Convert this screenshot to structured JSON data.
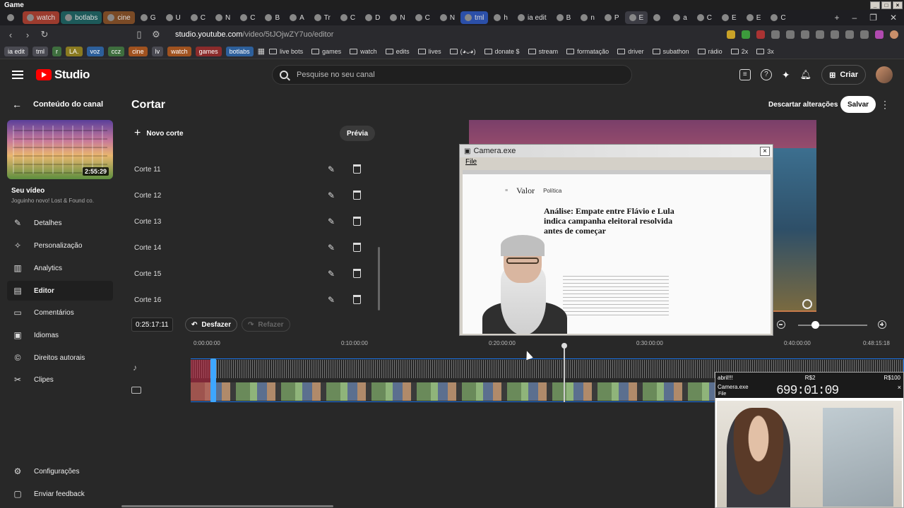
{
  "os": {
    "title": "Game"
  },
  "tabs": [
    {
      "label": "",
      "style": ""
    },
    {
      "label": "watch",
      "style": "pill-red"
    },
    {
      "label": "botlabs",
      "style": "pill-teal"
    },
    {
      "label": "cine",
      "style": "pill-orange"
    },
    {
      "label": "G",
      "style": ""
    },
    {
      "label": "U",
      "style": ""
    },
    {
      "label": "C",
      "style": ""
    },
    {
      "label": "N",
      "style": ""
    },
    {
      "label": "C",
      "style": ""
    },
    {
      "label": "B",
      "style": ""
    },
    {
      "label": "A",
      "style": ""
    },
    {
      "label": "Tr",
      "style": ""
    },
    {
      "label": "C",
      "style": ""
    },
    {
      "label": "D",
      "style": ""
    },
    {
      "label": "N",
      "style": ""
    },
    {
      "label": "C",
      "style": ""
    },
    {
      "label": "N",
      "style": ""
    },
    {
      "label": "tml",
      "style": "pill-blue"
    },
    {
      "label": "h",
      "style": ""
    },
    {
      "label": "ia edit",
      "style": ""
    },
    {
      "label": "B",
      "style": ""
    },
    {
      "label": "n",
      "style": ""
    },
    {
      "label": "P",
      "style": ""
    },
    {
      "label": "E",
      "style": "active"
    },
    {
      "label": "",
      "style": ""
    },
    {
      "label": "a",
      "style": ""
    },
    {
      "label": "C",
      "style": ""
    },
    {
      "label": "E",
      "style": ""
    },
    {
      "label": "E",
      "style": ""
    },
    {
      "label": "C",
      "style": ""
    }
  ],
  "address": {
    "domain": "studio.youtube.com",
    "path": "/video/5tJOjwZY7uo/editor"
  },
  "bookmarks": {
    "chips": [
      {
        "label": "ia edit",
        "style": ""
      },
      {
        "label": "tml",
        "style": ""
      },
      {
        "label": "r",
        "style": "green"
      },
      {
        "label": "LA.",
        "style": "yellow"
      },
      {
        "label": "voz",
        "style": "blue"
      },
      {
        "label": "ccz",
        "style": "green"
      },
      {
        "label": "cine",
        "style": "orange"
      },
      {
        "label": "lv",
        "style": ""
      },
      {
        "label": "watch",
        "style": "orange"
      },
      {
        "label": "games",
        "style": "red"
      },
      {
        "label": "botlabs",
        "style": "blue"
      }
    ],
    "folders": [
      "live bots",
      "games",
      "watch",
      "edits",
      "lives",
      "(◕ᴗ◕)",
      "donate $",
      "stream",
      "formatação",
      "driver",
      "subathon",
      "rádio",
      "2x",
      "3x"
    ]
  },
  "header": {
    "logo": "Studio",
    "search_placeholder": "Pesquise no seu canal",
    "create_label": "Criar"
  },
  "sidebar": {
    "back_label": "Conteúdo do canal",
    "thumb_duration": "2:55:29",
    "video_title": "Seu vídeo",
    "video_subtitle": "Joguinho novo! Lost & Found co.",
    "items": [
      {
        "label": "Detalhes",
        "icon": "pencil-icon"
      },
      {
        "label": "Personalização",
        "icon": "magic-wand-icon"
      },
      {
        "label": "Analytics",
        "icon": "analytics-icon"
      },
      {
        "label": "Editor",
        "icon": "film-icon"
      },
      {
        "label": "Comentários",
        "icon": "comment-icon"
      },
      {
        "label": "Idiomas",
        "icon": "subtitles-icon"
      },
      {
        "label": "Direitos autorais",
        "icon": "copyright-icon"
      },
      {
        "label": "Clipes",
        "icon": "scissors-icon"
      }
    ],
    "settings_label": "Configurações",
    "feedback_label": "Enviar feedback"
  },
  "editor": {
    "title": "Cortar",
    "discard_label": "Descartar alterações",
    "save_label": "Salvar",
    "new_cut_label": "Novo corte",
    "preview_label": "Prévia",
    "cuts": [
      "Corte 11",
      "Corte 12",
      "Corte 13",
      "Corte 14",
      "Corte 15",
      "Corte 16"
    ],
    "current_time": "0:25:17:11",
    "undo_label": "Desfazer",
    "redo_label": "Refazer",
    "timeline_labels": [
      "0:00:00:00",
      "0:10:00:00",
      "0:20:00:00",
      "0:30:00:00",
      "0:40:00:00",
      "0:48:15:18"
    ]
  },
  "camera_window": {
    "title": "Camera.exe",
    "menu_file": "File",
    "article_site": "Valor",
    "article_section": "Política",
    "article_title": "Análise: Empate entre Flávio e Lula indica campanha eleitoral resolvida antes de começar"
  },
  "camera2": {
    "chat_text": "abril!!!",
    "r1": "R$2",
    "r2": "R$100",
    "counter": "699:01:09",
    "title": "Camera.exe",
    "menu_file": "File"
  },
  "colors": {
    "accent": "#3ea6ff",
    "brand": "#ff0000",
    "bg": "#282828"
  }
}
